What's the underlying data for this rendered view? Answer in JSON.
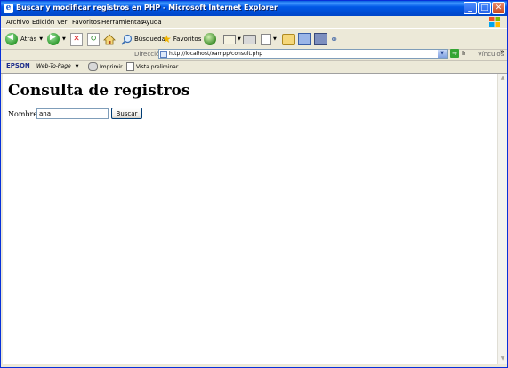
{
  "window": {
    "title": "Buscar y modificar registros en PHP - Microsoft Internet Explorer"
  },
  "menu": {
    "items": [
      "Archivo",
      "Edición",
      "Ver",
      "Favoritos",
      "Herramientas",
      "Ayuda"
    ]
  },
  "toolbar": {
    "back_label": "Atrás",
    "search_label": "Búsqueda",
    "favorites_label": "Favoritos"
  },
  "address": {
    "label": "Dirección",
    "url": "http://localhost/xampp/consult.php",
    "go_label": "Ir",
    "links_label": "Vínculos"
  },
  "links_bar": {
    "brand": "EPSON",
    "web_to_page": "Web-To-Page",
    "print_label": "Imprimir",
    "preview_label": "Vista preliminar"
  },
  "page": {
    "heading": "Consulta de registros",
    "name_label": "Nombre:",
    "name_value": "ana",
    "search_button": "Buscar"
  },
  "colors": {
    "titlebar": "#0058E6",
    "chrome": "#ECE9D8",
    "content_bg": "#FFFFFF"
  }
}
